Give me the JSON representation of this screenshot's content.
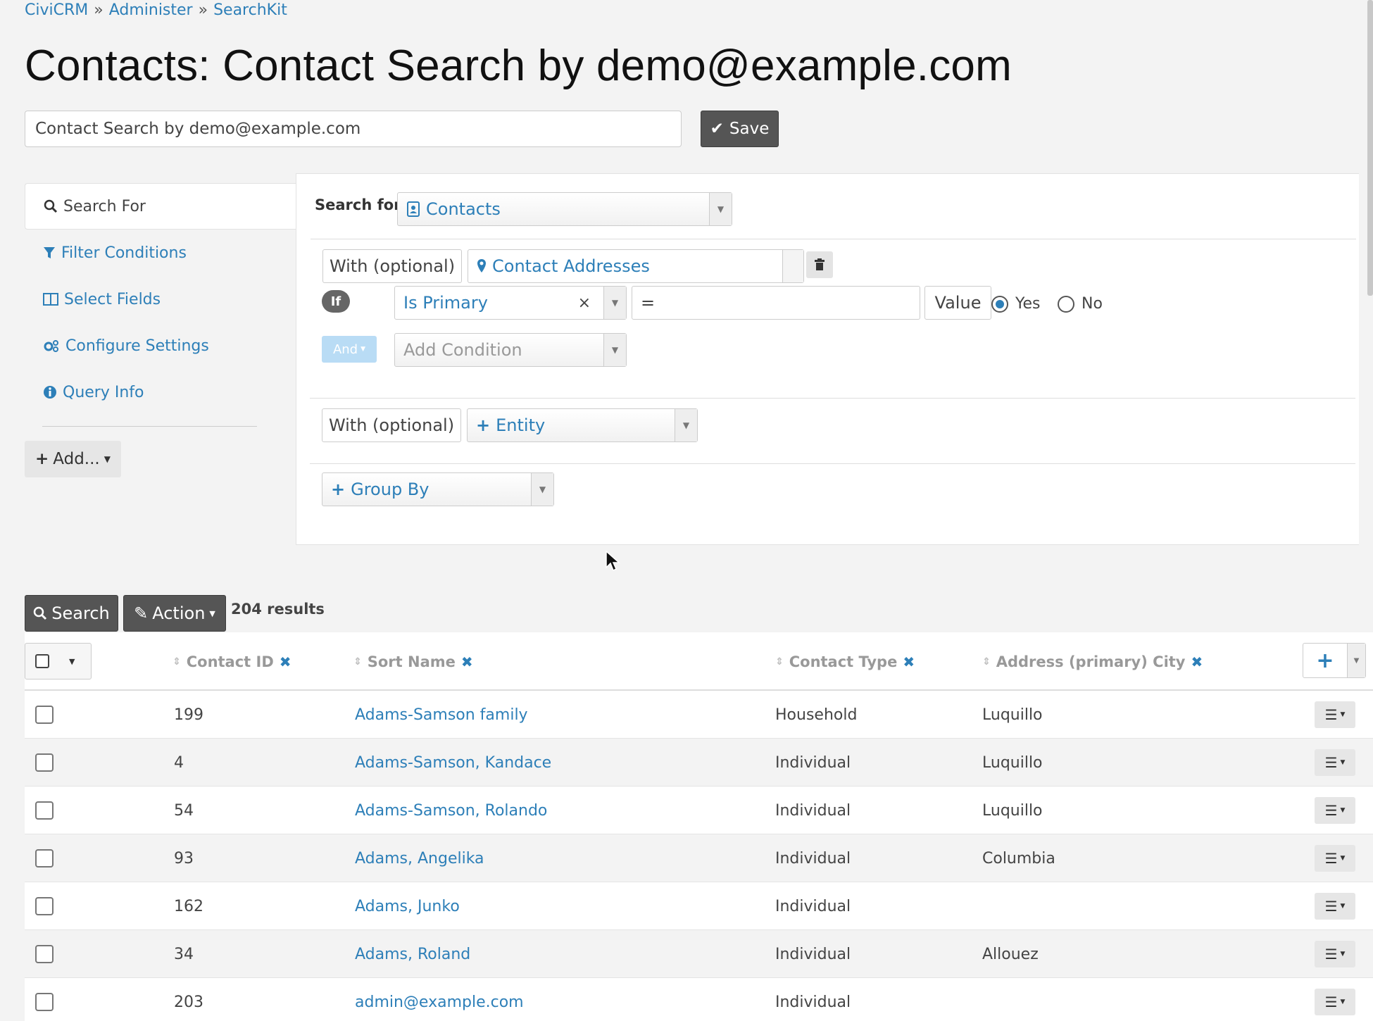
{
  "breadcrumb": {
    "items": [
      "CiviCRM",
      "Administer",
      "SearchKit"
    ]
  },
  "page_title": "Contacts: Contact Search by demo@example.com",
  "search_name": {
    "value": "Contact Search by demo@example.com"
  },
  "save_label": "Save",
  "tabs": [
    {
      "label": "Search For",
      "icon": "search-icon"
    },
    {
      "label": "Filter Conditions",
      "icon": "filter-icon"
    },
    {
      "label": "Select Fields",
      "icon": "columns-icon"
    },
    {
      "label": "Configure Settings",
      "icon": "gears-icon"
    },
    {
      "label": "Query Info",
      "icon": "info-icon"
    }
  ],
  "add_label": "Add...",
  "search_for": {
    "label": "Search for",
    "entity": "Contacts",
    "join1": {
      "prefix": "With (optional)",
      "entity": "Contact Addresses"
    },
    "condition": {
      "if_label": "If",
      "field": "Is Primary",
      "operator": "=",
      "value_label": "Value",
      "yes": "Yes",
      "no": "No",
      "selected": "Yes"
    },
    "and_label": "And",
    "add_condition_placeholder": "Add Condition",
    "join2": {
      "prefix": "With (optional)",
      "entity": "Entity"
    },
    "group_by": "Group By"
  },
  "toolbar": {
    "search_label": "Search",
    "action_label": "Action",
    "results": "204 results"
  },
  "table": {
    "columns": [
      "Contact ID",
      "Sort Name",
      "Contact Type",
      "Address (primary) City"
    ],
    "rows": [
      {
        "id": "199",
        "name": "Adams-Samson family",
        "type": "Household",
        "city": "Luquillo"
      },
      {
        "id": "4",
        "name": "Adams-Samson, Kandace",
        "type": "Individual",
        "city": "Luquillo"
      },
      {
        "id": "54",
        "name": "Adams-Samson, Rolando",
        "type": "Individual",
        "city": "Luquillo"
      },
      {
        "id": "93",
        "name": "Adams, Angelika",
        "type": "Individual",
        "city": "Columbia"
      },
      {
        "id": "162",
        "name": "Adams, Junko",
        "type": "Individual",
        "city": ""
      },
      {
        "id": "34",
        "name": "Adams, Roland",
        "type": "Individual",
        "city": "Allouez"
      },
      {
        "id": "203",
        "name": "admin@example.com",
        "type": "Individual",
        "city": ""
      }
    ]
  },
  "colors": {
    "link": "#2d7fb8",
    "dark_button": "#555555",
    "page_bg": "#f3f3f3"
  }
}
